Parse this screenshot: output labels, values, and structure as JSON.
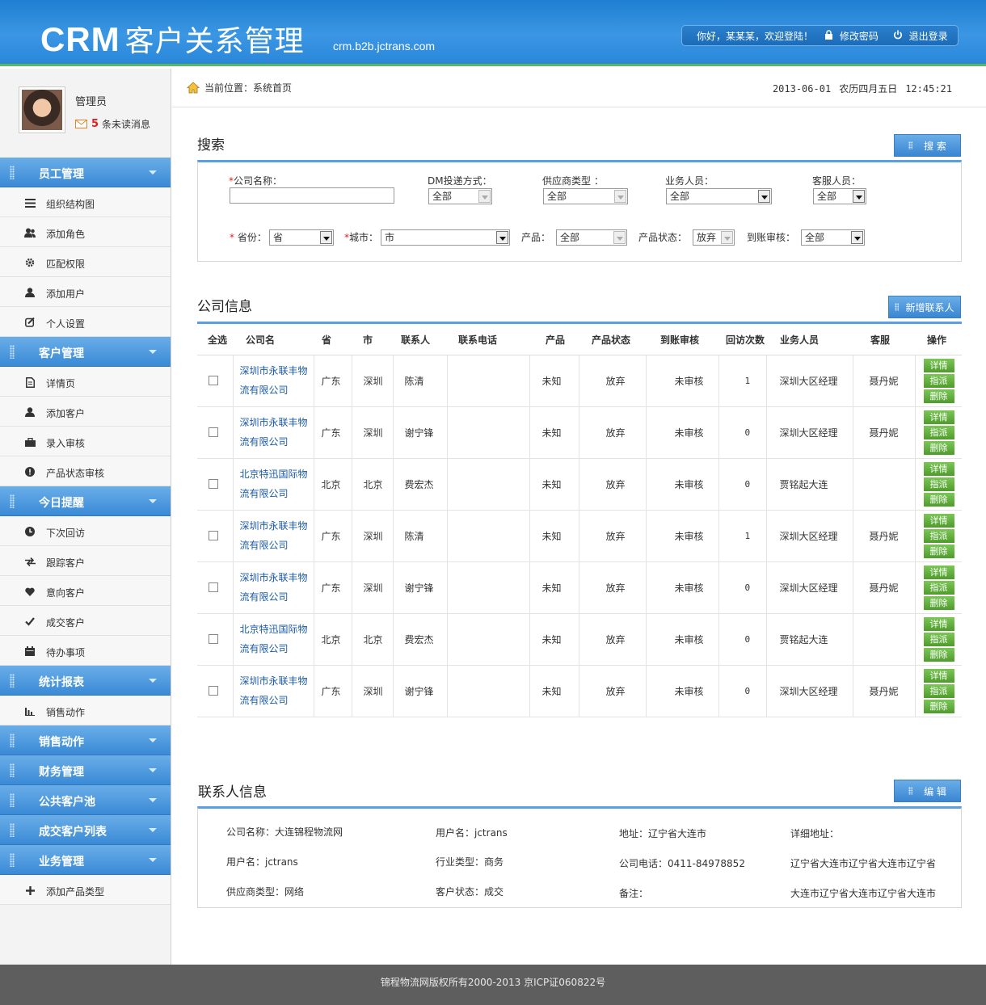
{
  "header": {
    "logo": "CRM",
    "title": "客户关系管理",
    "url": "crm.b2b.jctrans.com",
    "welcome": "你好，某某某，欢迎登陆！",
    "change_password": "修改密码",
    "logout": "退出登录"
  },
  "profile": {
    "role": "管理员",
    "unread_count": "5",
    "unread_label": "条未读消息"
  },
  "sidebar": {
    "sections": [
      {
        "label": "员工管理",
        "items": [
          "组织结构图",
          "添加角色",
          "匹配权限",
          "添加用户",
          "个人设置"
        ]
      },
      {
        "label": "客户管理",
        "items": [
          "详情页",
          "添加客户",
          "录入审核",
          "产品状态审核"
        ]
      },
      {
        "label": "今日提醒",
        "items": [
          "下次回访",
          "跟踪客户",
          "意向客户",
          "成交客户",
          "待办事项"
        ]
      },
      {
        "label": "统计报表",
        "items": [
          "销售动作"
        ]
      },
      {
        "label": "销售动作",
        "items": []
      },
      {
        "label": "财务管理",
        "items": []
      },
      {
        "label": "公共客户池",
        "items": []
      },
      {
        "label": "成交客户列表",
        "items": []
      },
      {
        "label": "业务管理",
        "items": [
          "添加产品类型"
        ]
      }
    ]
  },
  "breadcrumb": {
    "label": "当前位置：系统首页",
    "date": "2013-06-01",
    "lunar": "农历四月五日",
    "time": "12:45:21"
  },
  "search": {
    "title": "搜索",
    "button": "搜 索",
    "company_label": "公司名称：",
    "company_value": "",
    "dm_label": "DM投递方式：",
    "dm_value": "全部",
    "supplier_label": "供应商类型 ：",
    "supplier_value": "全部",
    "sales_label": "业务人员：",
    "sales_value": "全部",
    "service_label": "客服人员：",
    "service_value": "全部",
    "province_label": "省份：",
    "province_value": "省",
    "city_label": "城市：",
    "city_value": "市",
    "product_label": "产品：",
    "product_value": "全部",
    "status_label": "产品状态：",
    "status_value": "放弃",
    "audit_label": "到账审核：",
    "audit_value": "全部"
  },
  "company": {
    "title": "公司信息",
    "add_button": "新增联系人",
    "columns": [
      "全选",
      "公司名",
      "省",
      "市",
      "联系人",
      "联系电话",
      "产品",
      "产品状态",
      "到账审核",
      "回访次数",
      "业务人员",
      "客服",
      "操作"
    ],
    "actions": [
      "详情",
      "指派",
      "删除"
    ],
    "rows": [
      {
        "name1": "深圳市永联丰物",
        "name2": "流有限公司",
        "province": "广东",
        "city": "深圳",
        "contact": "陈清",
        "phone": "",
        "product": "未知",
        "status": "放弃",
        "audit": "未审核",
        "visits": "1",
        "sales": "深圳大区经理",
        "service": "聂丹妮"
      },
      {
        "name1": "深圳市永联丰物",
        "name2": "流有限公司",
        "province": "广东",
        "city": "深圳",
        "contact": "谢宁锋",
        "phone": "",
        "product": "未知",
        "status": "放弃",
        "audit": "未审核",
        "visits": "0",
        "sales": "深圳大区经理",
        "service": "聂丹妮"
      },
      {
        "name1": "北京特迅国际物",
        "name2": "流有限公司",
        "province": "北京",
        "city": "北京",
        "contact": "费宏杰",
        "phone": "",
        "product": "未知",
        "status": "放弃",
        "audit": "未审核",
        "visits": "0",
        "sales": "贾铭起大连",
        "service": ""
      },
      {
        "name1": "深圳市永联丰物",
        "name2": "流有限公司",
        "province": "广东",
        "city": "深圳",
        "contact": "陈清",
        "phone": "",
        "product": "未知",
        "status": "放弃",
        "audit": "未审核",
        "visits": "1",
        "sales": "深圳大区经理",
        "service": "聂丹妮"
      },
      {
        "name1": "深圳市永联丰物",
        "name2": "流有限公司",
        "province": "广东",
        "city": "深圳",
        "contact": "谢宁锋",
        "phone": "",
        "product": "未知",
        "status": "放弃",
        "audit": "未审核",
        "visits": "0",
        "sales": "深圳大区经理",
        "service": "聂丹妮"
      },
      {
        "name1": "北京特迅国际物",
        "name2": "流有限公司",
        "province": "北京",
        "city": "北京",
        "contact": "费宏杰",
        "phone": "",
        "product": "未知",
        "status": "放弃",
        "audit": "未审核",
        "visits": "0",
        "sales": "贾铭起大连",
        "service": ""
      },
      {
        "name1": "深圳市永联丰物",
        "name2": "流有限公司",
        "province": "广东",
        "city": "深圳",
        "contact": "谢宁锋",
        "phone": "",
        "product": "未知",
        "status": "放弃",
        "audit": "未审核",
        "visits": "0",
        "sales": "深圳大区经理",
        "service": "聂丹妮"
      }
    ]
  },
  "contact": {
    "title": "联系人信息",
    "edit_button": "编 辑",
    "company_name": "公司名称：大连锦程物流网",
    "username1": "用户名：jctrans",
    "address": "地址：辽宁省大连市",
    "detail_address_label": "详细地址：",
    "username2": "用户名：jctrans",
    "industry": "行业类型：商务",
    "phone": "公司电话：0411-84978852",
    "detail_address_1": "辽宁省大连市辽宁省大连市辽宁省",
    "supplier_type": "供应商类型：网络",
    "customer_status": "客户状态：成交",
    "remark": "备注：",
    "detail_address_2": "大连市辽宁省大连市辽宁省大连市"
  },
  "footer": {
    "text": "锦程物流网版权所有2000-2013 京ICP证060822号"
  }
}
